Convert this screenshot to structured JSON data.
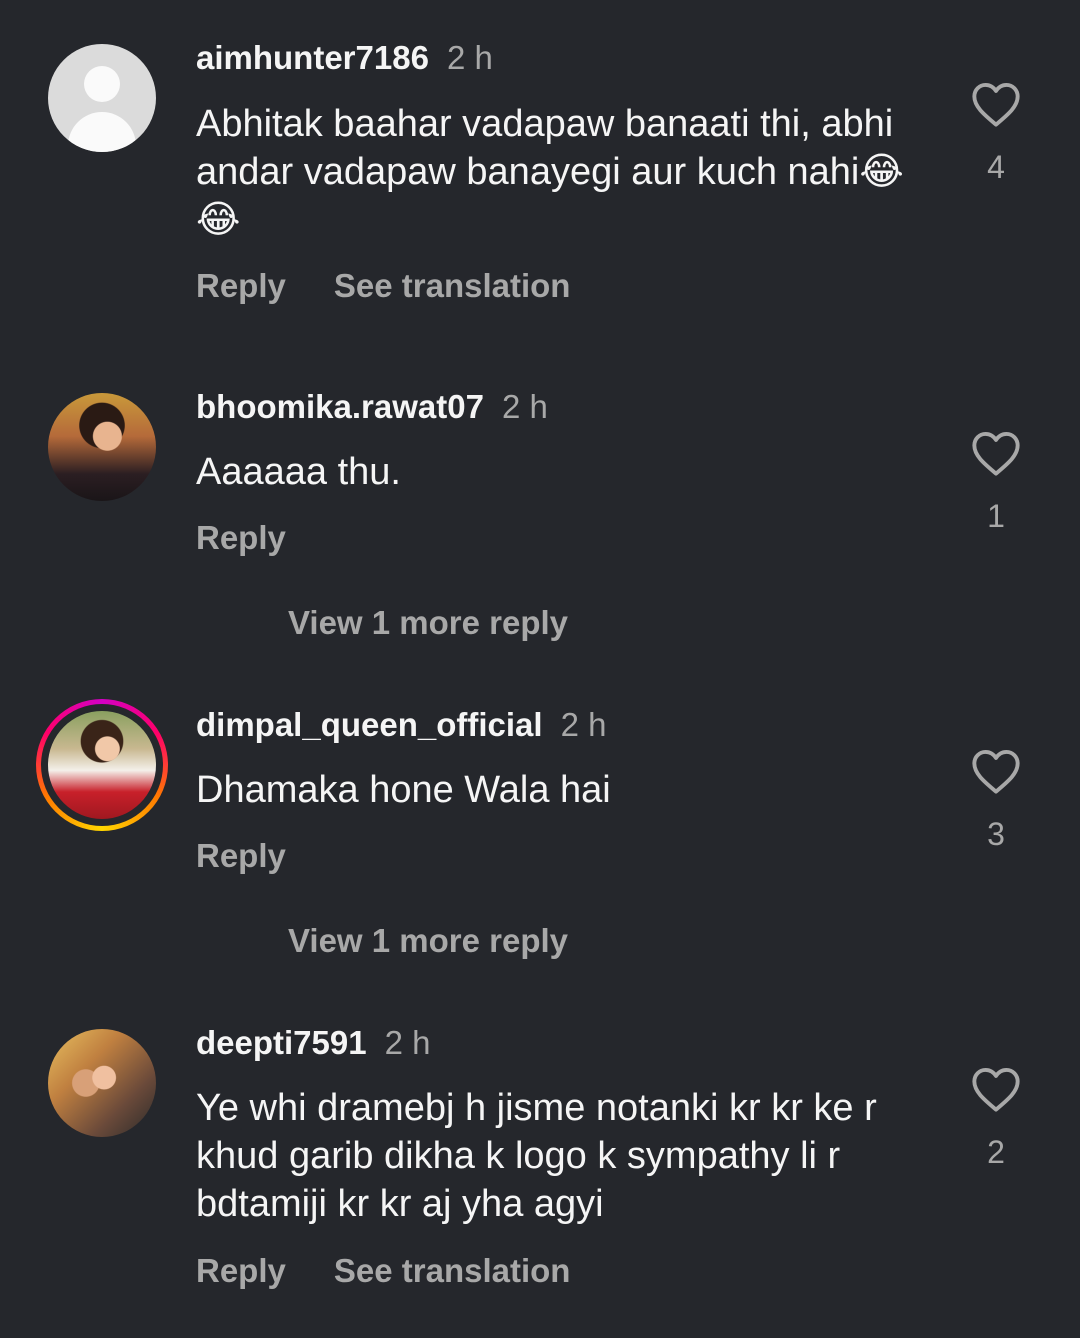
{
  "comments": [
    {
      "username": "aimhunter7186",
      "time": "2 h",
      "text": "Abhitak baahar vadapaw banaati thi, abhi andar vadapaw banayegi aur kuch nahi😂😂",
      "likes": "4",
      "reply_label": "Reply",
      "translate_label": "See translation"
    },
    {
      "username": "bhoomika.rawat07",
      "time": "2 h",
      "text": "Aaaaaa thu.",
      "likes": "1",
      "reply_label": "Reply",
      "view_replies_label": "View 1 more reply"
    },
    {
      "username": "dimpal_queen_official",
      "time": "2 h",
      "text": "Dhamaka hone Wala hai",
      "likes": "3",
      "reply_label": "Reply",
      "view_replies_label": "View 1 more reply"
    },
    {
      "username": "deepti7591",
      "time": "2 h",
      "text": "Ye whi dramebj h jisme notanki kr kr ke r khud garib dikha k logo k sympathy li r bdtamiji kr kr aj yha agyi",
      "likes": "2",
      "reply_label": "Reply",
      "translate_label": "See translation"
    }
  ],
  "icons": {
    "like": "heart-outline-icon",
    "default_avatar": "default-user-icon"
  },
  "colors": {
    "background": "#25272c",
    "primary_text": "#f5f5f5",
    "secondary_text": "#a8a8a8"
  }
}
